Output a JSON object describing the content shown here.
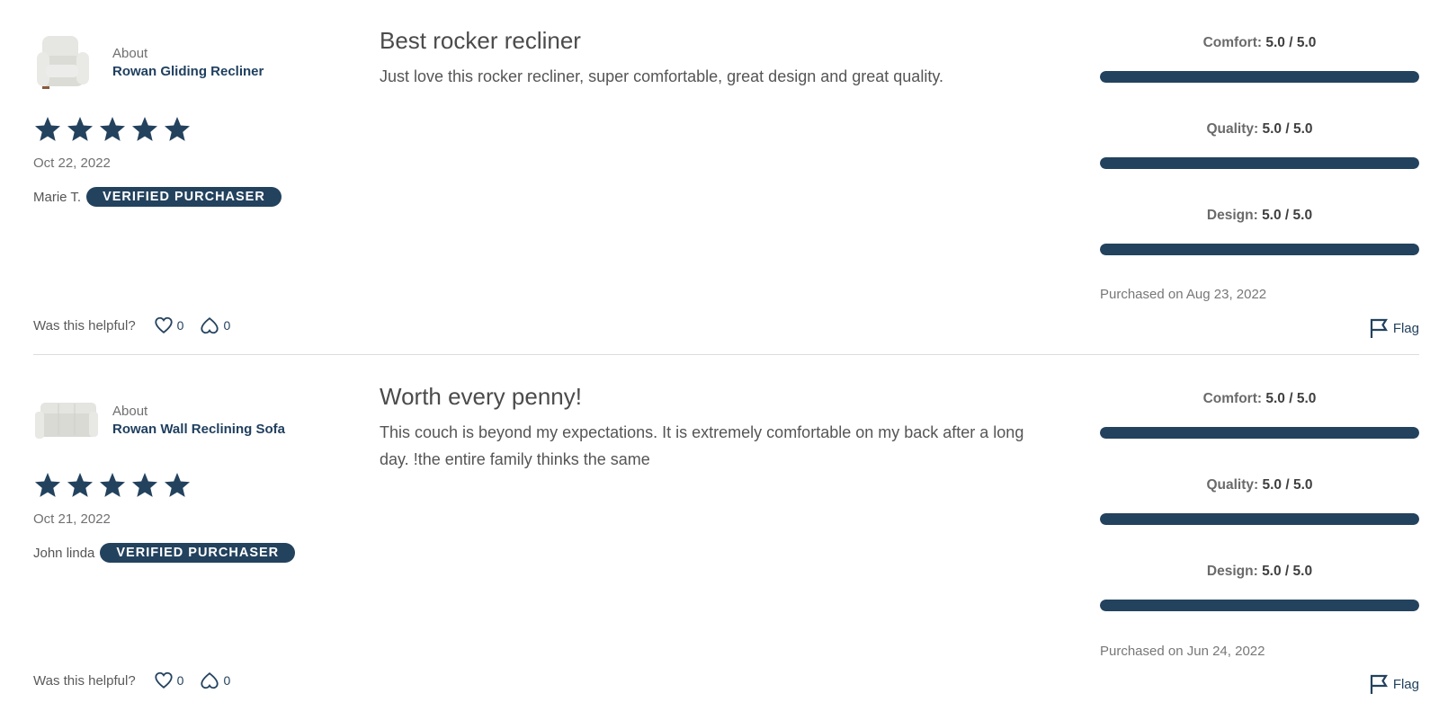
{
  "colors": {
    "accent": "#23425e",
    "text": "#555555",
    "muted": "#777777",
    "divider": "#dcdcdc"
  },
  "reviews": [
    {
      "about_label": "About",
      "product_name": "Rowan Gliding Recliner",
      "product_image": "recliner-chair-thumbnail",
      "stars": 5,
      "max_stars": 5,
      "date": "Oct 22, 2022",
      "reviewer": "Marie T.",
      "badge": "VERIFIED PURCHASER",
      "title": "Best rocker recliner",
      "body": "Just love this rocker recliner, super comfortable, great design and great quality.",
      "ratings": [
        {
          "label": "Comfort:",
          "value_text": "5.0 / 5.0",
          "value": 5.0,
          "max": 5.0
        },
        {
          "label": "Quality:",
          "value_text": "5.0 / 5.0",
          "value": 5.0,
          "max": 5.0
        },
        {
          "label": "Design:",
          "value_text": "5.0 / 5.0",
          "value": 5.0,
          "max": 5.0
        }
      ],
      "purchased": "Purchased on Aug 23, 2022",
      "helpful_label": "Was this helpful?",
      "helpful_count": "0",
      "unhelpful_count": "0",
      "flag_label": "Flag"
    },
    {
      "about_label": "About",
      "product_name": "Rowan Wall Reclining Sofa",
      "product_image": "sofa-thumbnail",
      "stars": 5,
      "max_stars": 5,
      "date": "Oct 21, 2022",
      "reviewer": "John linda",
      "badge": "VERIFIED PURCHASER",
      "title": "Worth every penny!",
      "body": "This couch is beyond my expectations. It is extremely comfortable on my back after a long day. !the entire family thinks the same",
      "ratings": [
        {
          "label": "Comfort:",
          "value_text": "5.0 / 5.0",
          "value": 5.0,
          "max": 5.0
        },
        {
          "label": "Quality:",
          "value_text": "5.0 / 5.0",
          "value": 5.0,
          "max": 5.0
        },
        {
          "label": "Design:",
          "value_text": "5.0 / 5.0",
          "value": 5.0,
          "max": 5.0
        }
      ],
      "purchased": "Purchased on Jun 24, 2022",
      "helpful_label": "Was this helpful?",
      "helpful_count": "0",
      "unhelpful_count": "0",
      "flag_label": "Flag"
    }
  ]
}
